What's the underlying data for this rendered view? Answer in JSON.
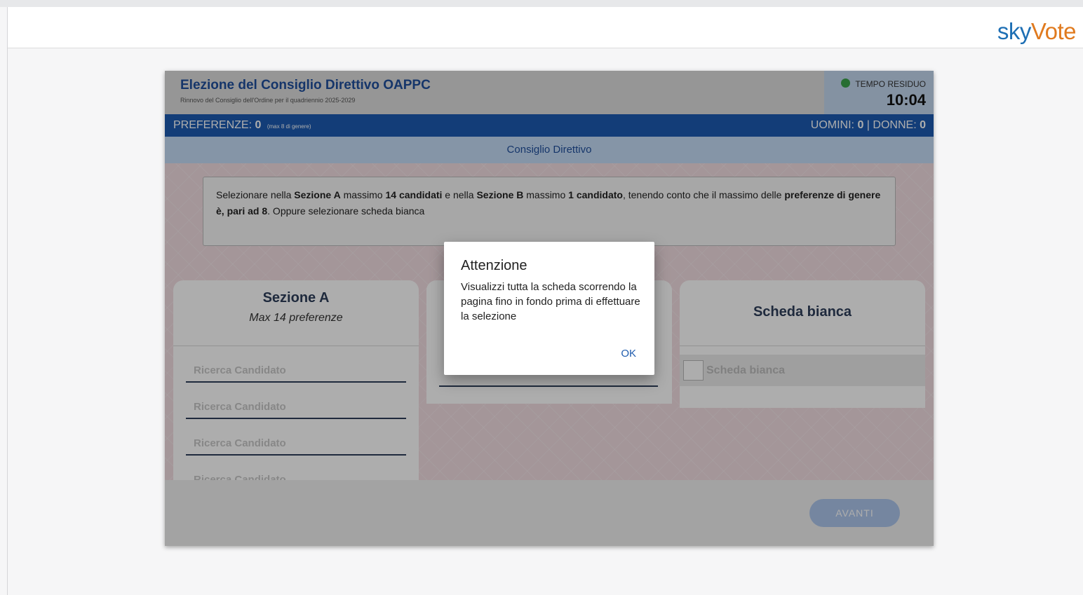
{
  "brand": {
    "sky": "sky",
    "vote": "Vote"
  },
  "election": {
    "title": "Elezione del Consiglio Direttivo OAPPC",
    "subtitle": "Rinnovo del Consiglio dell'Ordine per il quadriennio 2025-2029"
  },
  "timer": {
    "label": "TEMPO RESIDUO",
    "value": "10:04",
    "status_color": "#3aa34a"
  },
  "preferences": {
    "label": "PREFERENZE:",
    "count": "0",
    "note": "(max 8 di genere)",
    "uomini_label": "UOMINI:",
    "uomini": "0",
    "separator": "|",
    "donne_label": "DONNE:",
    "donne": "0"
  },
  "section_title": "Consiglio Direttivo",
  "instruction": {
    "p1": "Selezionare nella ",
    "b1": "Sezione A",
    "p2": " massimo ",
    "b2": "14 candidati",
    "p3": " e nella ",
    "b3": "Sezione B",
    "p4": " massimo ",
    "b4": "1 candidato",
    "p5": ", tenendo conto che il massimo delle ",
    "b5": "preferenze di genere è, pari ad 8",
    "p6": ". Oppure selezionare scheda bianca"
  },
  "sections": {
    "a": {
      "title": "Sezione A",
      "subtitle": "Max 14 preferenze",
      "search_placeholders": [
        "Ricerca Candidato",
        "Ricerca Candidato",
        "Ricerca Candidato",
        "Ricerca Candidato"
      ]
    },
    "c": {
      "title": "Scheda bianca",
      "option_label": "Scheda bianca"
    }
  },
  "footer": {
    "next_label": "AVANTI"
  },
  "modal": {
    "title": "Attenzione",
    "message": "Visualizzi tutta la scheda scorrendo la pagina fino in fondo prima di effettuare la selezione",
    "ok_label": "OK"
  }
}
